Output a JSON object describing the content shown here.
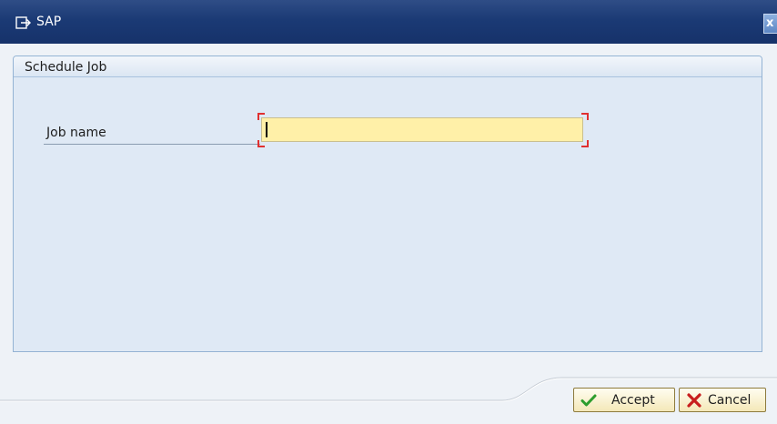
{
  "window": {
    "title": "SAP",
    "app_icon": "sap-window-icon",
    "close_icon": "close-icon",
    "close_glyph": "x"
  },
  "dialog": {
    "group_title": "Schedule Job",
    "field": {
      "label": "Job name",
      "value": "",
      "required": true
    }
  },
  "buttons": {
    "accept": {
      "label": "Accept",
      "icon": "checkmark-icon"
    },
    "cancel": {
      "label": "Cancel",
      "icon": "cancel-x-icon"
    }
  },
  "colors": {
    "titlebar": "#1b3a75",
    "input_background": "#fff0a8",
    "required_marker": "#e03030",
    "accept_check": "#2d9d2d",
    "cancel_x": "#c81e1e"
  }
}
